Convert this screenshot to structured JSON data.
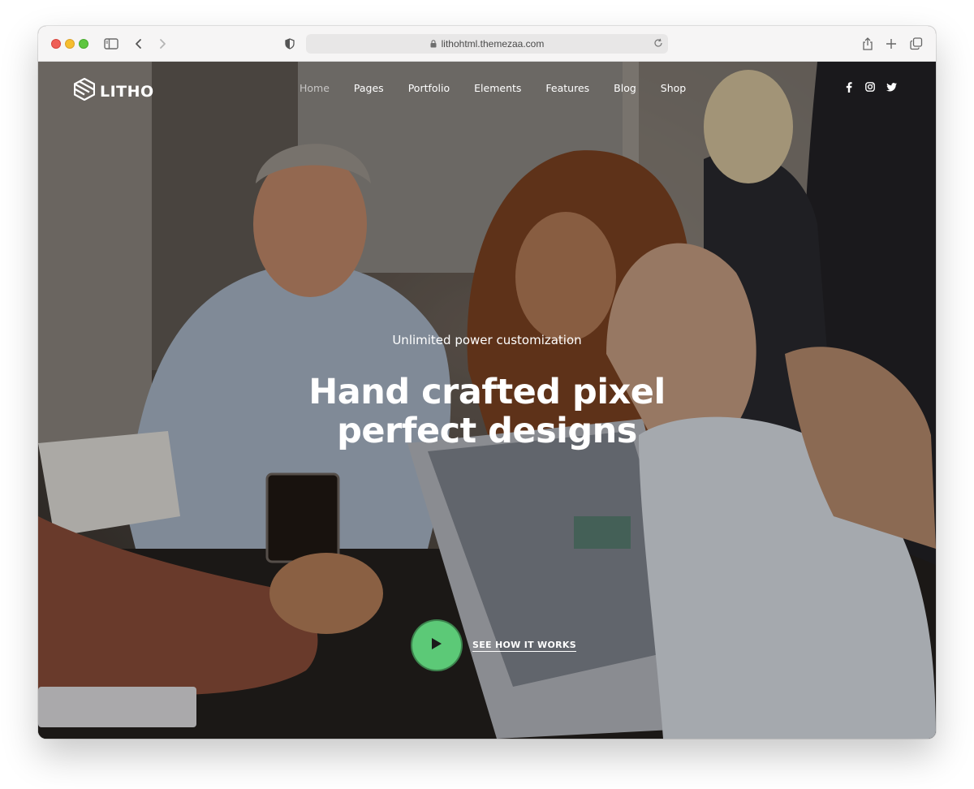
{
  "browser": {
    "url": "lithohtml.themezaa.com",
    "icons": [
      "sidebar-icon",
      "back-icon",
      "forward-icon",
      "shield-icon",
      "lock-icon",
      "reload-icon",
      "share-icon",
      "new-tab-icon",
      "tabs-icon"
    ]
  },
  "site": {
    "logo_text": "LITHO",
    "nav": [
      {
        "label": "Home",
        "active": true
      },
      {
        "label": "Pages"
      },
      {
        "label": "Portfolio"
      },
      {
        "label": "Elements"
      },
      {
        "label": "Features"
      },
      {
        "label": "Blog"
      },
      {
        "label": "Shop"
      }
    ],
    "social": [
      "facebook-icon",
      "instagram-icon",
      "twitter-icon"
    ]
  },
  "hero": {
    "subtitle": "Unlimited power customization",
    "headline_line1": "Hand crafted pixel",
    "headline_line2": "perfect designs",
    "cta_label": "SEE HOW IT WORKS",
    "accent_color": "#5cc977"
  }
}
